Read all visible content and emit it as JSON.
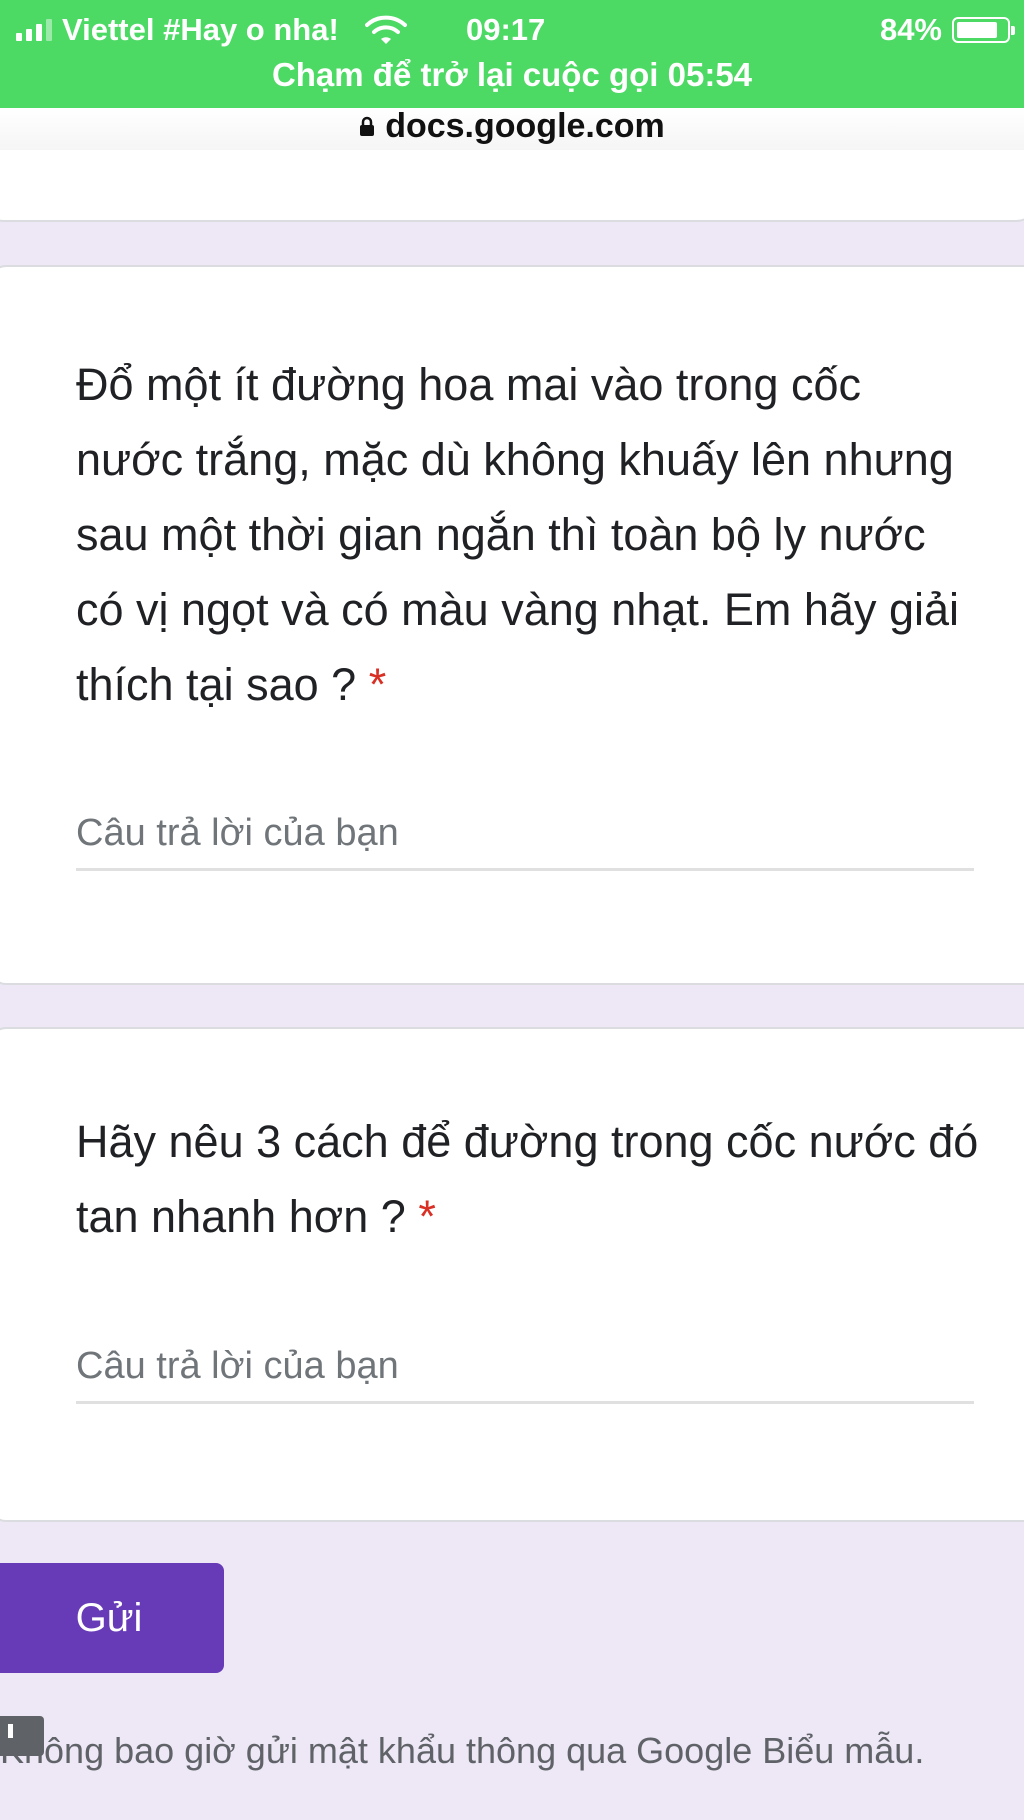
{
  "status_bar": {
    "carrier": "Viettel #Hay o nha!",
    "time": "09:17",
    "battery": "84%",
    "battery_level": 0.84,
    "call_banner": "Chạm để trở lại cuộc gọi 05:54"
  },
  "browser": {
    "url": "docs.google.com"
  },
  "form": {
    "questions": [
      {
        "text": "Đổ một ít đường hoa mai vào trong cốc nước trắng, mặc dù không khuấy lên nhưng sau một thời gian ngắn thì toàn bộ ly nước có vị ngọt và có màu vàng nhạt. Em hãy giải thích tại sao ?",
        "required_mark": "*",
        "answer_placeholder": "Câu trả lời của bạn"
      },
      {
        "text": "Hãy nêu 3 cách để đường trong cốc nước đó tan nhanh hơn ?",
        "required_mark": "*",
        "answer_placeholder": "Câu trả lời của bạn"
      }
    ],
    "submit_label": "Gửi",
    "footer_note": "Không bao giờ gửi mật khẩu thông qua Google Biểu mẫu."
  },
  "colors": {
    "status_bar": "#4cd964",
    "page_background": "#ede7f6",
    "submit_button": "#673ab7",
    "required": "#d93025"
  },
  "icons": [
    "signal-icon",
    "wifi-icon",
    "battery-icon",
    "lock-icon",
    "report-icon"
  ]
}
